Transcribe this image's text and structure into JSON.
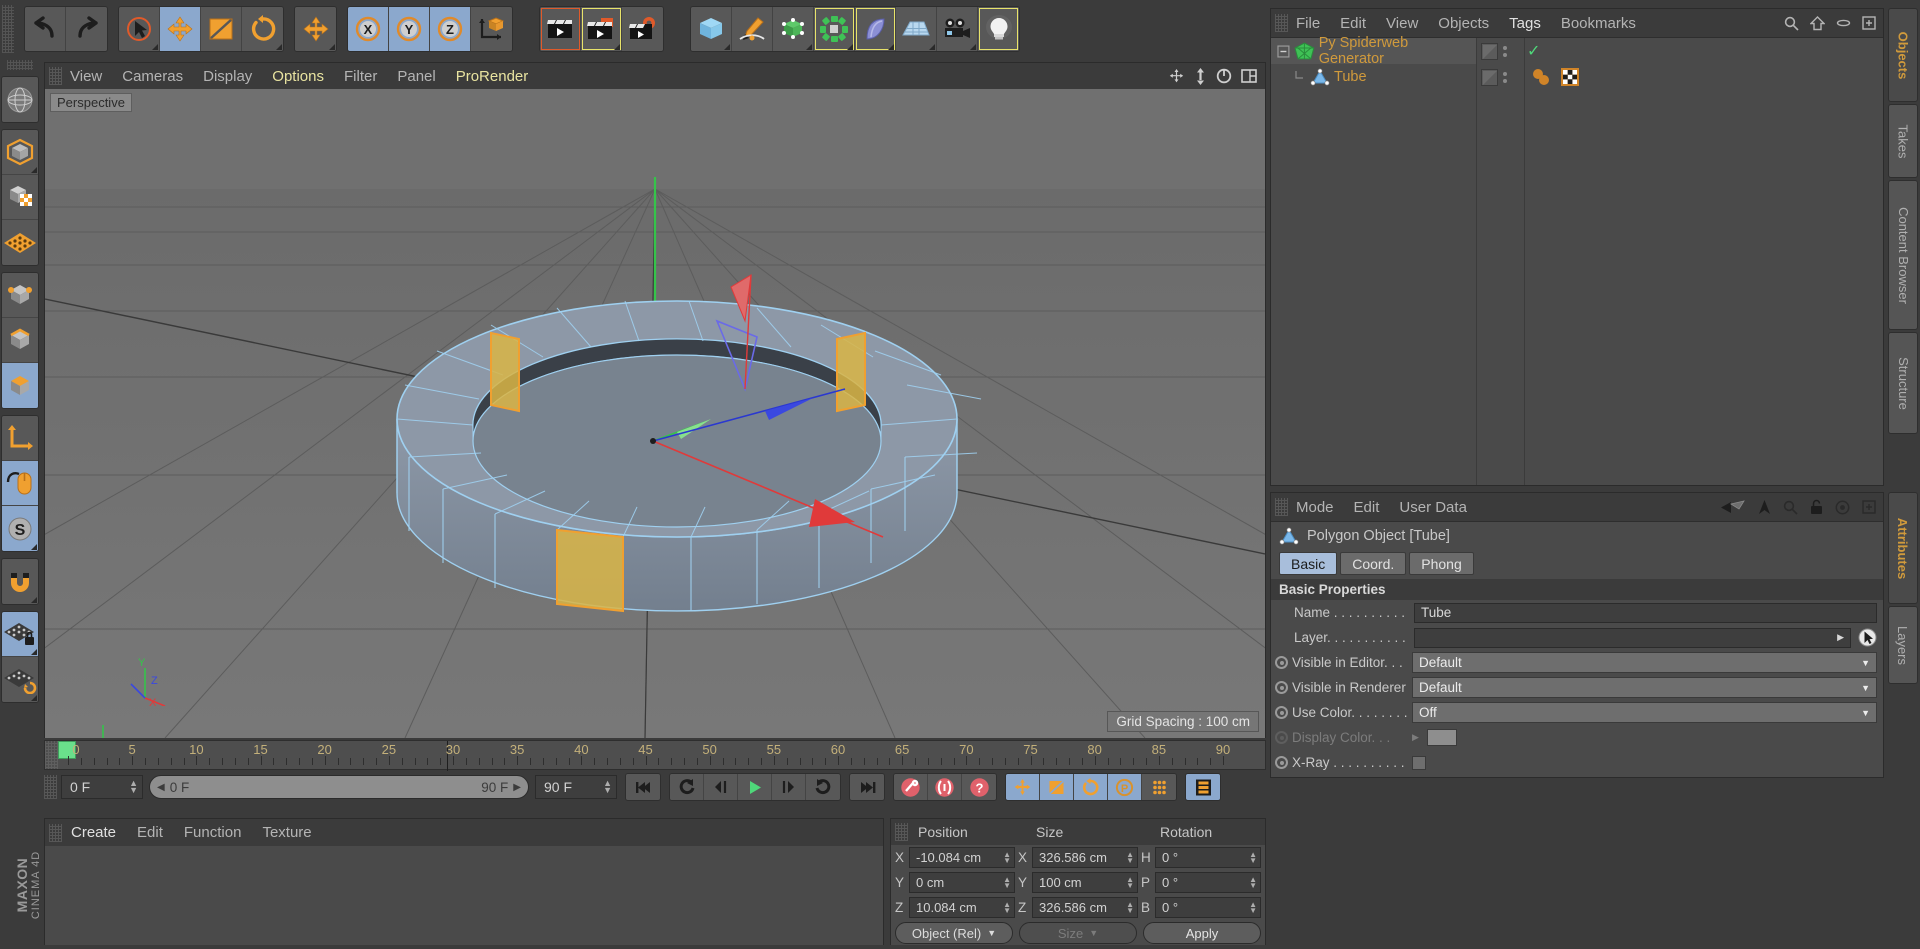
{
  "app": {
    "brand": "MAXON",
    "brand_sub": "CINEMA 4D"
  },
  "toolbar": {
    "groups": [
      {
        "name": "undo-redo",
        "buttons": [
          {
            "icon": "undo-icon",
            "label": "Undo",
            "state": "normal"
          },
          {
            "icon": "redo-icon",
            "label": "Redo",
            "state": "normal"
          }
        ]
      },
      {
        "name": "transform-tools",
        "buttons": [
          {
            "icon": "live-selection-icon",
            "label": "Live Selection",
            "state": "normal"
          },
          {
            "icon": "move-icon",
            "label": "Move",
            "state": "active"
          },
          {
            "icon": "scale-icon",
            "label": "Scale",
            "state": "normal"
          },
          {
            "icon": "rotate-icon",
            "label": "Rotate",
            "state": "normal"
          }
        ]
      },
      {
        "name": "world-axis",
        "buttons": [
          {
            "icon": "move-world-icon",
            "label": "World/Object Axis",
            "state": "normal"
          }
        ]
      },
      {
        "name": "axis-locks",
        "buttons": [
          {
            "icon": "x-axis-icon",
            "label": "X Axis",
            "state": "active"
          },
          {
            "icon": "y-axis-icon",
            "label": "Y Axis",
            "state": "active"
          },
          {
            "icon": "z-axis-icon",
            "label": "Z Axis",
            "state": "active"
          },
          {
            "icon": "world-coordinates-icon",
            "label": "World Coordinate System",
            "state": "normal"
          }
        ]
      },
      {
        "name": "render-tools",
        "buttons": [
          {
            "icon": "render-view-icon",
            "label": "Render View",
            "state": "outline-red"
          },
          {
            "icon": "render-to-picture-viewer-icon",
            "label": "Render to Picture Viewer",
            "state": "outline-yellow"
          },
          {
            "icon": "render-settings-icon",
            "label": "Edit Render Settings",
            "state": "normal"
          }
        ]
      },
      {
        "name": "object-creation",
        "buttons": [
          {
            "icon": "cube-primitive-icon",
            "label": "Add Cube Object",
            "state": "normal"
          },
          {
            "icon": "spline-pen-icon",
            "label": "Add Spline",
            "state": "normal"
          },
          {
            "icon": "generator-nurbs-icon",
            "label": "Add Generator",
            "state": "normal"
          },
          {
            "icon": "mograph-icon",
            "label": "Add MoGraph Object",
            "state": "outline-yellow"
          },
          {
            "icon": "deformer-icon",
            "label": "Add Deformer",
            "state": "outline-yellow"
          },
          {
            "icon": "environment-icon",
            "label": "Add Scene Object",
            "state": "normal"
          },
          {
            "icon": "camera-icon",
            "label": "Add Camera",
            "state": "normal"
          },
          {
            "icon": "light-icon",
            "label": "Add Light",
            "state": "outline-yellow"
          }
        ]
      }
    ]
  },
  "left_toolbar": {
    "groups": [
      {
        "name": "view-mode",
        "buttons": [
          {
            "icon": "globe-undo-view-icon",
            "label": "Undo View",
            "state": "normal"
          }
        ]
      },
      {
        "name": "editor-modes",
        "buttons": [
          {
            "icon": "model-mode-icon",
            "label": "Model Mode",
            "state": "normal"
          },
          {
            "icon": "texture-mode-icon",
            "label": "Texture Mode",
            "state": "normal"
          },
          {
            "icon": "workplane-mode-icon",
            "label": "Workplane Mode",
            "state": "normal"
          }
        ]
      },
      {
        "name": "component-modes",
        "buttons": [
          {
            "icon": "points-mode-icon",
            "label": "Points Mode",
            "state": "normal"
          },
          {
            "icon": "edges-mode-icon",
            "label": "Edges Mode",
            "state": "normal"
          },
          {
            "icon": "polygons-mode-icon",
            "label": "Polygons Mode",
            "state": "active"
          }
        ]
      },
      {
        "name": "axis-tools",
        "buttons": [
          {
            "icon": "object-axis-icon",
            "label": "Enable Axis Modification",
            "state": "normal"
          },
          {
            "icon": "enable-mouse-icon",
            "label": "Viewport Solo",
            "state": "active"
          },
          {
            "icon": "snap-mode-icon",
            "label": "Enable Snapping",
            "state": "active"
          }
        ]
      },
      {
        "name": "magnet-tools",
        "buttons": [
          {
            "icon": "magnet-icon",
            "label": "Magnet Tool",
            "state": "normal"
          }
        ]
      },
      {
        "name": "workplane-tools",
        "buttons": [
          {
            "icon": "workplane-lock-icon",
            "label": "Lock Workplane",
            "state": "active"
          },
          {
            "icon": "workplane-rotate-icon",
            "label": "Planar Workplane Mode",
            "state": "normal"
          }
        ]
      }
    ]
  },
  "viewport": {
    "menu": [
      "View",
      "Cameras",
      "Display",
      "Options",
      "Filter",
      "Panel",
      "ProRender"
    ],
    "menu_highlighted": [
      "Options",
      "ProRender"
    ],
    "view_label": "Perspective",
    "grid_spacing": "Grid Spacing : 100 cm",
    "axis_gizmo": {
      "y": "Y",
      "z": "Z",
      "x": "X"
    },
    "corner_icons": [
      "move-view-icon",
      "scale-view-icon",
      "rotate-view-icon",
      "viewport-layout-icon"
    ]
  },
  "timeline": {
    "ticks": [
      "0",
      "5",
      "10",
      "15",
      "20",
      "25",
      "30",
      "35",
      "40",
      "45",
      "50",
      "55",
      "60",
      "65",
      "70",
      "75",
      "80",
      "85",
      "90"
    ],
    "range_start": "0 F",
    "range_end": "90 F",
    "current_frame": "0 F",
    "end_field": "90 F",
    "preview_min": "0 F",
    "preview_max": "90 F",
    "transport": [
      {
        "icon": "go-to-start-icon",
        "label": "Go To Start Frame"
      },
      {
        "icon": "previous-key-icon",
        "label": "Go To Previous Key"
      },
      {
        "icon": "step-back-icon",
        "label": "Go To Previous Frame"
      },
      {
        "icon": "play-icon",
        "label": "Play Forwards"
      },
      {
        "icon": "step-forward-icon",
        "label": "Go To Next Frame"
      },
      {
        "icon": "next-key-icon",
        "label": "Go To Next Key"
      },
      {
        "icon": "go-to-end-icon",
        "label": "Go To End Frame"
      }
    ],
    "record_tools": [
      {
        "icon": "record-key-icon",
        "label": "Record Active Objects",
        "state": "normal"
      },
      {
        "icon": "autokeying-icon",
        "label": "Autokeying",
        "state": "normal"
      },
      {
        "icon": "keyframe-selection-icon",
        "label": "Keyframe Selection",
        "state": "normal"
      }
    ],
    "key_toggles": [
      {
        "icon": "position-key-icon",
        "label": "Position",
        "state": "active"
      },
      {
        "icon": "scale-key-icon",
        "label": "Scale",
        "state": "active"
      },
      {
        "icon": "rotation-key-icon",
        "label": "Rotation",
        "state": "active"
      },
      {
        "icon": "parameter-key-icon",
        "label": "Parameter",
        "state": "active"
      },
      {
        "icon": "pla-key-icon",
        "label": "Point Level Animation",
        "state": "normal"
      }
    ],
    "extra": [
      {
        "icon": "timeline-icon",
        "label": "Animation Layer",
        "state": "active"
      }
    ]
  },
  "material_manager": {
    "menu": [
      "Create",
      "Edit",
      "Function",
      "Texture"
    ],
    "menu_highlighted": [
      "Create"
    ]
  },
  "coordinates": {
    "headers": [
      "Position",
      "Size",
      "Rotation"
    ],
    "rows": [
      {
        "pos_label": "X",
        "pos_value": "-10.084 cm",
        "size_label": "X",
        "size_value": "326.586 cm",
        "rot_label": "H",
        "rot_value": "0 °"
      },
      {
        "pos_label": "Y",
        "pos_value": "0 cm",
        "size_label": "Y",
        "size_value": "100 cm",
        "rot_label": "P",
        "rot_value": "0 °"
      },
      {
        "pos_label": "Z",
        "pos_value": "10.084 cm",
        "size_label": "Z",
        "size_value": "326.586 cm",
        "rot_label": "B",
        "rot_value": "0 °"
      }
    ],
    "mode_dropdown": "Object (Rel)",
    "size_dropdown": "Size",
    "apply_button": "Apply"
  },
  "object_manager": {
    "menu": [
      "File",
      "Edit",
      "View",
      "Objects",
      "Tags",
      "Bookmarks"
    ],
    "menu_highlighted": [
      "Tags"
    ],
    "header_icons": [
      "search-icon",
      "home-icon",
      "minimize-icon",
      "maximize-icon"
    ],
    "items": [
      {
        "name": "Py Spiderweb Generator",
        "icon": "mograph-green-icon",
        "depth": 0,
        "selected": true,
        "visibility_check": "✓",
        "tags": [
          "python-tag-icon",
          "texture-tag-icon"
        ]
      },
      {
        "name": "Tube",
        "icon": "polygon-object-icon",
        "depth": 1,
        "selected": false,
        "visibility_check": "",
        "tags": []
      }
    ]
  },
  "attribute_manager": {
    "menu": [
      "Mode",
      "Edit",
      "User Data"
    ],
    "header_icons": [
      "back-arrow-icon",
      "up-arrow-icon",
      "search-icon",
      "lock-icon",
      "target-icon",
      "maximize-icon"
    ],
    "object_title": "Polygon Object [Tube]",
    "object_icon": "polygon-object-icon",
    "tabs": [
      {
        "label": "Basic",
        "active": true
      },
      {
        "label": "Coord.",
        "active": false
      },
      {
        "label": "Phong",
        "active": false
      }
    ],
    "section_title": "Basic Properties",
    "properties": [
      {
        "label": "Name . . . . . . . . . . .",
        "type": "text",
        "value": "Tube",
        "radio": false,
        "dim": false
      },
      {
        "label": "Layer. . . . . . . . . . . .",
        "type": "layer",
        "value": "",
        "radio": false,
        "dim": false
      },
      {
        "label": "Visible in Editor. . .",
        "type": "dropdown",
        "value": "Default",
        "radio": true,
        "dim": false
      },
      {
        "label": "Visible in Renderer",
        "type": "dropdown",
        "value": "Default",
        "radio": true,
        "dim": false
      },
      {
        "label": "Use Color. . . . . . . .",
        "type": "dropdown",
        "value": "Off",
        "radio": true,
        "dim": false
      },
      {
        "label": "Display Color. . .",
        "type": "swatch",
        "value": "",
        "radio": true,
        "dim": true
      },
      {
        "label": "X-Ray . . . . . . . . . . .",
        "type": "checkbox",
        "value": "",
        "radio": true,
        "dim": false
      }
    ]
  },
  "vertical_tabs": {
    "top": [
      {
        "label": "Objects",
        "active": true
      },
      {
        "label": "Takes",
        "active": false
      },
      {
        "label": "Content Browser",
        "active": false
      },
      {
        "label": "Structure",
        "active": false
      }
    ],
    "bottom": [
      {
        "label": "Attributes",
        "active": true
      },
      {
        "label": "Layers",
        "active": false
      }
    ]
  },
  "colors": {
    "accent_orange": "#d09a3c",
    "active_blue": "#8ba8cd",
    "highlight_yellow": "#e8e36a",
    "selection_orange": "#f0a030",
    "mesh_blue": "#9fd0f0"
  }
}
